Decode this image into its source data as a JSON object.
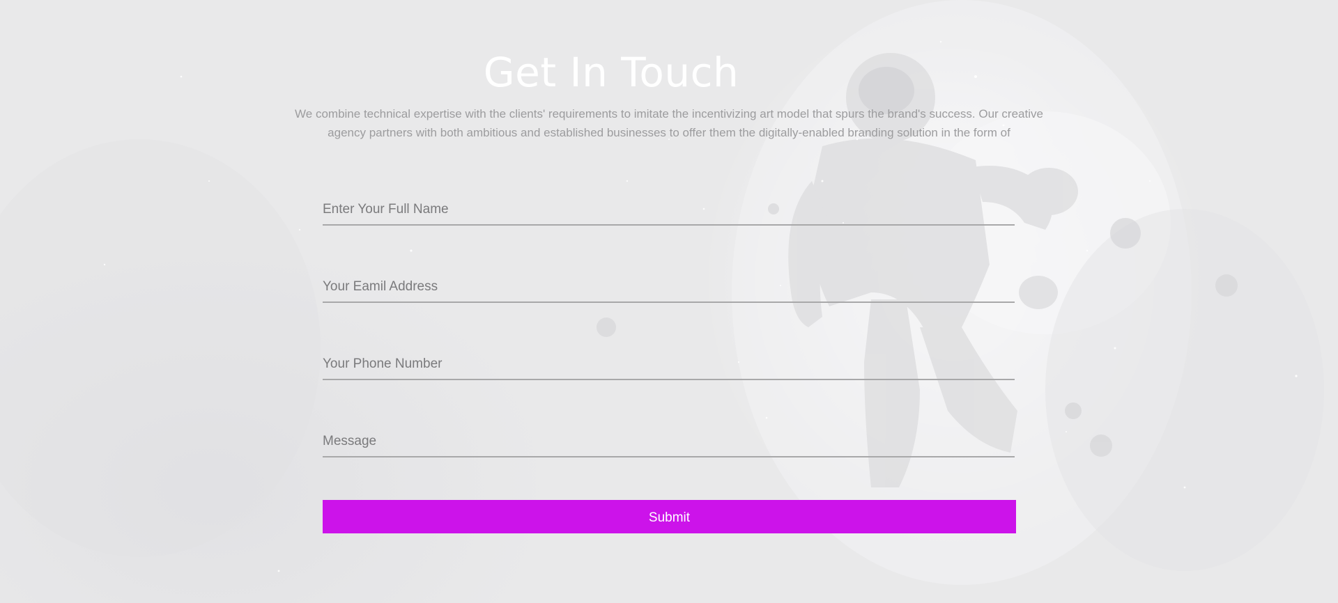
{
  "page": {
    "title": "Get In Touch",
    "intro": "We combine technical expertise with the clients' requirements to imitate the incentivizing art model that spurs the brand's success. Our creative agency partners with both ambitious and established businesses to offer them the digitally-enabled branding solution in the form of"
  },
  "form": {
    "name_placeholder": "Enter Your Full Name",
    "email_placeholder": "Your Eamil Address",
    "phone_placeholder": "Your Phone Number",
    "message_placeholder": "Message",
    "submit_label": "Submit"
  },
  "colors": {
    "background": "#e9e9ea",
    "title": "#ffffff",
    "accent": "#cc13ea",
    "input_line": "#a8a8a9"
  },
  "icons": {
    "background_image": "astronaut-in-space-image"
  }
}
